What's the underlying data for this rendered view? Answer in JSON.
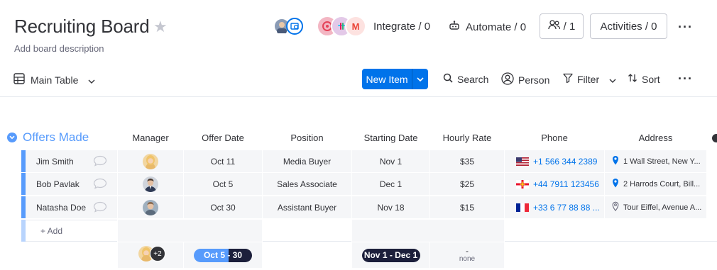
{
  "header": {
    "title": "Recruiting Board",
    "description": "Add board description",
    "integrate_label": "Integrate / 0",
    "automate_label": "Automate / 0",
    "members_label": "/ 1",
    "activities_label": "Activities / 0",
    "integration_badge_letter": "M"
  },
  "toolbar": {
    "view_label": "Main Table",
    "new_item_label": "New Item",
    "search_label": "Search",
    "person_label": "Person",
    "filter_label": "Filter",
    "sort_label": "Sort"
  },
  "group": {
    "title": "Offers Made",
    "color": "#579bfc",
    "columns": [
      "Manager",
      "Offer Date",
      "Position",
      "Starting Date",
      "Hourly Rate",
      "Phone",
      "Address"
    ],
    "rows": [
      {
        "name": "Jim Smith",
        "offer_date": "Oct 11",
        "position": "Media Buyer",
        "starting_date": "Nov 1",
        "hourly_rate": "$35",
        "phone": "+1 566 344 2389",
        "flag": "us",
        "address": "1 Wall Street, New Y..."
      },
      {
        "name": "Bob Pavlak",
        "offer_date": "Oct 5",
        "position": "Sales Associate",
        "starting_date": "Dec 1",
        "hourly_rate": "$25",
        "phone": "+44 7911 123456",
        "flag": "gg",
        "address": "2 Harrods Court, Bill..."
      },
      {
        "name": "Natasha Doe",
        "offer_date": "Oct 30",
        "position": "Assistant Buyer",
        "starting_date": "Nov 18",
        "hourly_rate": "$15",
        "phone": "+33 6 77 88 88 ...",
        "flag": "fr",
        "address": "Tour Eiffel, Avenue A..."
      }
    ],
    "add_label": "+ Add",
    "summary": {
      "manager_extra": "+2",
      "offer_range": "Oct 5 - 30",
      "start_range": "Nov 1 - Dec 1",
      "rate_dash": "-",
      "rate_none": "none"
    }
  },
  "colors": {
    "primary": "#0073ea",
    "group_blue": "#579bfc",
    "cell_bg": "#f5f6f8",
    "pill_dark": "#1c1f3b"
  }
}
